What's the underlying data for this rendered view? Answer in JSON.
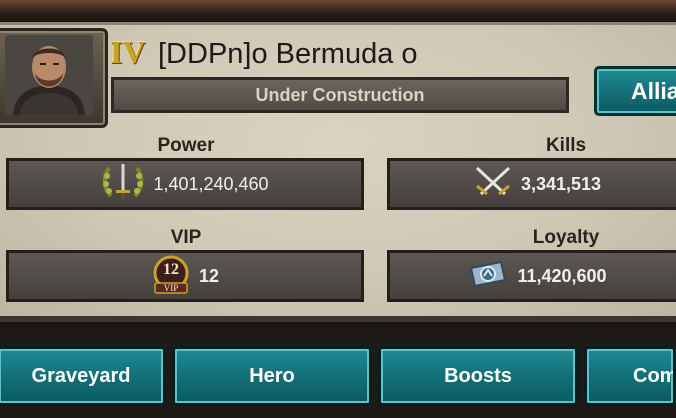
{
  "profile": {
    "rank": "IV",
    "name": "[DDPn]o Bermuda o",
    "title": "Under Construction",
    "alliance_button": "Allia"
  },
  "stats": {
    "power": {
      "label": "Power",
      "value": "1,401,240,460",
      "icon": "power-laurel-sword-icon"
    },
    "kills": {
      "label": "Kills",
      "value": "3,341,513",
      "icon": "crossed-swords-icon"
    },
    "vip": {
      "label": "VIP",
      "value": "12",
      "badge": "12",
      "badge_text": "VIP",
      "icon": "vip-badge-icon"
    },
    "loyalty": {
      "label": "Loyalty",
      "value": "11,420,600",
      "icon": "loyalty-token-icon"
    }
  },
  "nav": {
    "items": [
      {
        "label": "Graveyard"
      },
      {
        "label": "Hero"
      },
      {
        "label": "Boosts"
      },
      {
        "label": "Com"
      }
    ]
  },
  "colors": {
    "panel": "#cfc8b5",
    "stat_box": "#4f4a44",
    "button_teal": "#137078",
    "rank_gold": "#c9a227"
  }
}
